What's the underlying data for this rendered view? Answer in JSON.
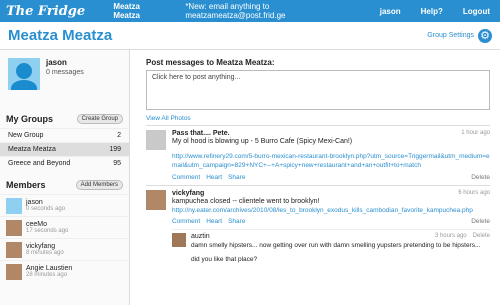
{
  "topbar": {
    "logo": "The Fridge",
    "group_link": "Meatza Meatza",
    "email_notice": "*New: email anything to meatzameatza@post.frid.ge",
    "user": "jason",
    "help": "Help?",
    "logout": "Logout"
  },
  "header": {
    "title": "Meatza Meatza",
    "settings": "Group Settings"
  },
  "profile": {
    "name": "jason",
    "messages": "0  messages"
  },
  "groups": {
    "title": "My Groups",
    "create": "Create Group",
    "items": [
      {
        "name": "New Group",
        "count": "2"
      },
      {
        "name": "Meatza Meatza",
        "count": "199"
      },
      {
        "name": "Greece and Beyond",
        "count": "95"
      }
    ]
  },
  "members": {
    "title": "Members",
    "add": "Add Members",
    "items": [
      {
        "name": "jason",
        "time": "0 seconds ago"
      },
      {
        "name": "ceeMo",
        "time": "17 seconds ago"
      },
      {
        "name": "vickyfang",
        "time": "8 minutes ago"
      },
      {
        "name": "Angie Laustien",
        "time": "28 minutes ago"
      }
    ]
  },
  "composer": {
    "label": "Post messages to Meatza Meatza:",
    "placeholder": "Click here to post anything..."
  },
  "view_photos": "View All Photos",
  "messages": [
    {
      "author": "Pass that.... Pete.",
      "time": "1 hour ago",
      "text": "My ol hood is blowing up - 5 Burro Cafe (Spicy Mexi-Can!)",
      "link": "http://www.refinery29.com/5-burro-mexican-restaurant-brooklyn.php?utm_source=Triggermail&utm_medium=email&utm_campaign=829+NYC+--+A+spicy+new+restaurant+and+an+outfit+to+match",
      "comment": "Comment",
      "heart": "Heart",
      "share": "Share",
      "delete": "Delete"
    },
    {
      "author": "vickyfang",
      "time": "6 hours ago",
      "text": "kampuchea closed -- clientele went to brooklyn!",
      "link": "http://ny.eater.com/archives/2010/08/les_to_brooklyn_exodus_kills_cambodian_favorite_kampuchea.php",
      "comment": "Comment",
      "heart": "Heart",
      "share": "Share",
      "delete": "Delete"
    }
  ],
  "reply": {
    "author": "auztin",
    "time": "3 hours ago",
    "delete": "Delete",
    "line1": "damn smelly hipsters... now getting over run with damn smelling yupsters pretending to be hipsters...",
    "line2": "did you like that place?"
  }
}
